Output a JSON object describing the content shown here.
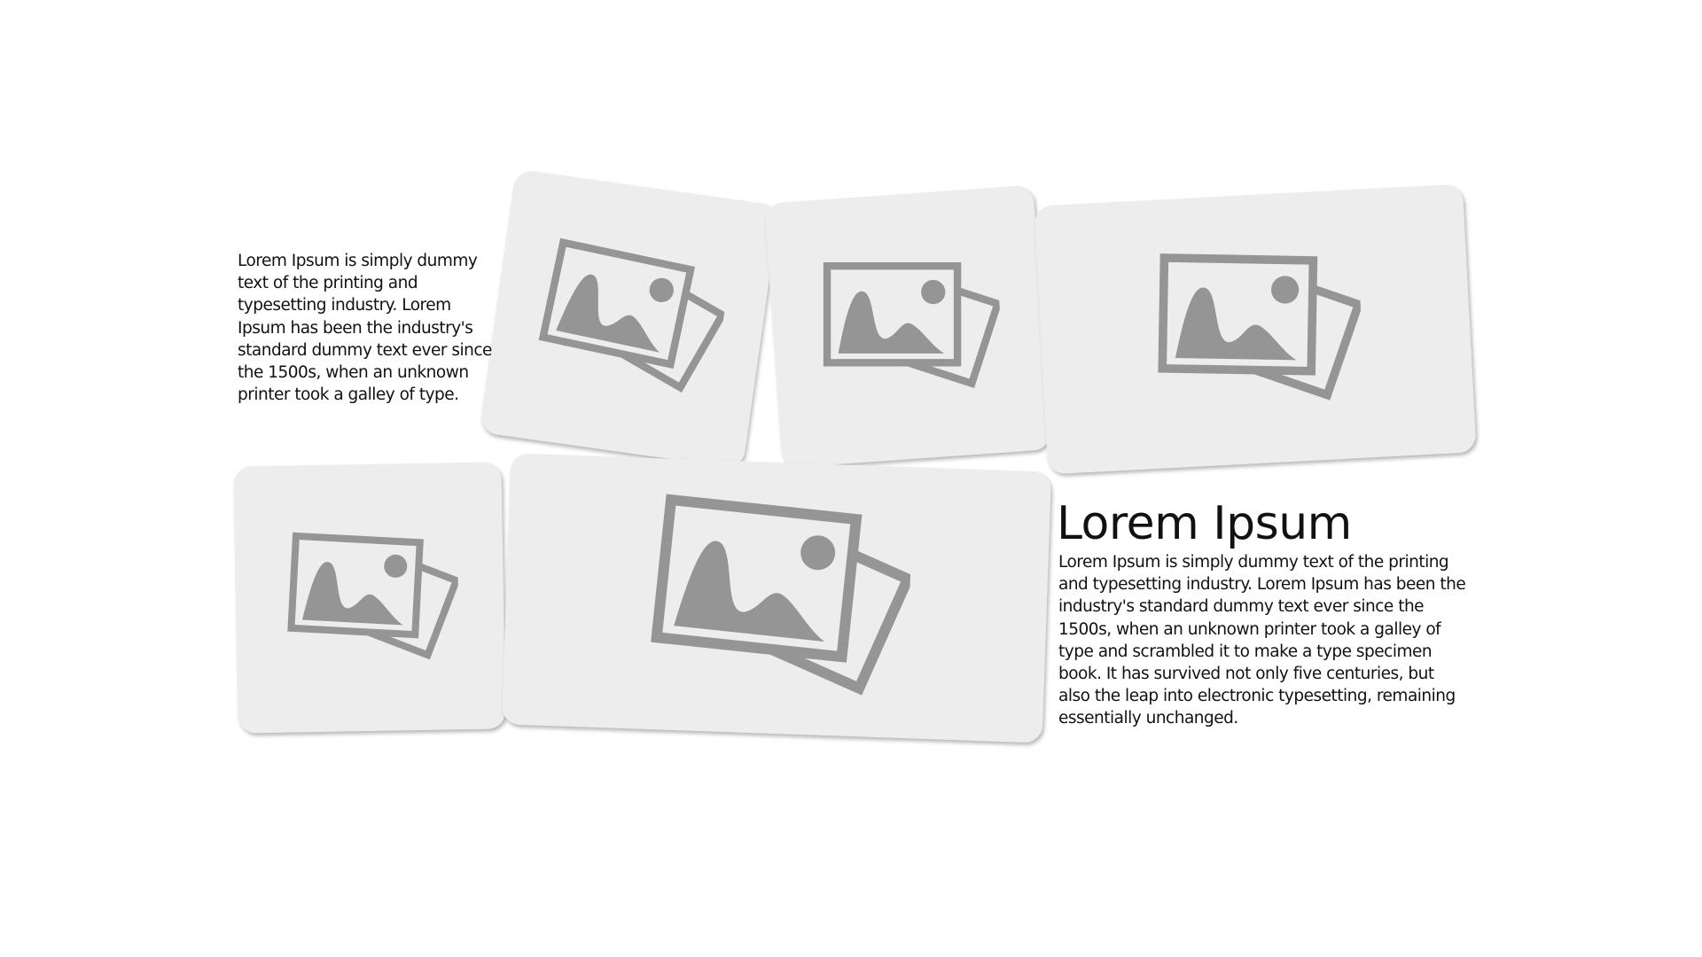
{
  "left_text": {
    "body": "Lorem Ipsum is simply dummy text of the printing and typesetting industry. Lorem Ipsum has been the industry's standard dummy text ever since the 1500s, when an unknown printer took a galley of type."
  },
  "right_text": {
    "title": "Lorem Ipsum",
    "body": "Lorem Ipsum is simply dummy text of the printing and typesetting industry. Lorem Ipsum has been the industry's standard dummy text ever since the 1500s, when an unknown printer took a galley of type and scrambled it to make a type specimen book. It has survived not only five centuries, but also the leap into electronic typesetting, remaining essentially unchanged."
  },
  "placeholders": [
    {
      "icon": "image-placeholder-icon"
    },
    {
      "icon": "image-placeholder-icon"
    },
    {
      "icon": "image-placeholder-icon"
    },
    {
      "icon": "image-placeholder-icon"
    },
    {
      "icon": "image-placeholder-icon"
    }
  ],
  "colors": {
    "card_background": "#ededed",
    "icon": "#959595",
    "text": "#111111"
  }
}
